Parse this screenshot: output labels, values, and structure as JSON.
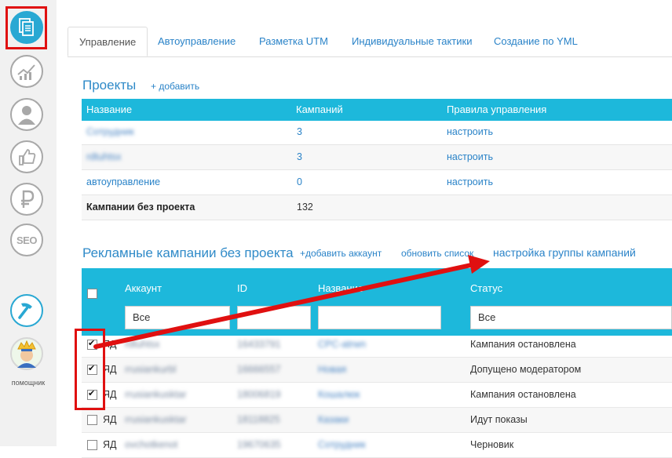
{
  "sidebar": {
    "items": [
      {
        "name": "documents",
        "active": true
      },
      {
        "name": "statistics"
      },
      {
        "name": "user"
      },
      {
        "name": "likes"
      },
      {
        "name": "ruble"
      },
      {
        "name": "seo",
        "label": "SEO"
      },
      {
        "name": "tools"
      },
      {
        "name": "helper"
      }
    ],
    "helper_label": "помощник"
  },
  "tabs": [
    {
      "label": "Управление",
      "active": true
    },
    {
      "label": "Автоуправление"
    },
    {
      "label": "Разметка UTM"
    },
    {
      "label": "Индивидуальные тактики"
    },
    {
      "label": "Создание по YML"
    }
  ],
  "projects": {
    "title": "Проекты",
    "add_label": "+ добавить",
    "columns": [
      "Название",
      "Кампаний",
      "Правила управления"
    ],
    "rows": [
      {
        "name": "Сотрудник",
        "campaigns": "3",
        "rules": "настроить",
        "blurred": true
      },
      {
        "name": "rdtuhtsx",
        "campaigns": "3",
        "rules": "настроить",
        "blurred": true
      },
      {
        "name": "автоуправление",
        "campaigns": "0",
        "rules": "настроить"
      }
    ],
    "no_project": {
      "label": "Кампании без проекта",
      "count": "132"
    }
  },
  "campaigns": {
    "title": "Рекламные кампании без проекта",
    "add_account": "+добавить аккаунт",
    "refresh": "обновить список",
    "group_settings": "настройка группы кампаний",
    "columns": [
      "Аккаунт",
      "ID",
      "Название",
      "Статус"
    ],
    "filters": {
      "account": "Все",
      "id": "",
      "name": "",
      "status": "Все"
    },
    "rows": [
      {
        "checked": true,
        "type": "ЯД",
        "account": "rdtuhtsx",
        "id": "16433791",
        "name": "CPC-atrwn",
        "status": "Кампания остановлена"
      },
      {
        "checked": true,
        "type": "ЯД",
        "account": "rrusiankurbl",
        "id": "16666557",
        "name": "Новая",
        "status": "Допущено модератором"
      },
      {
        "checked": true,
        "type": "ЯД",
        "account": "rrusiankusktar",
        "id": "18006819",
        "name": "Кошалюк",
        "status": "Кампания остановлена"
      },
      {
        "checked": false,
        "type": "ЯД",
        "account": "rrusiankusktar",
        "id": "18118825",
        "name": "Казаки",
        "status": "Идут показы"
      },
      {
        "checked": false,
        "type": "ЯД",
        "account": "ovchotkenot",
        "id": "19670635",
        "name": "Сотрудник",
        "status": "Черновик"
      }
    ]
  },
  "colors": {
    "accent": "#1db8db",
    "link": "#2a83c8",
    "annotation": "#e01010"
  }
}
